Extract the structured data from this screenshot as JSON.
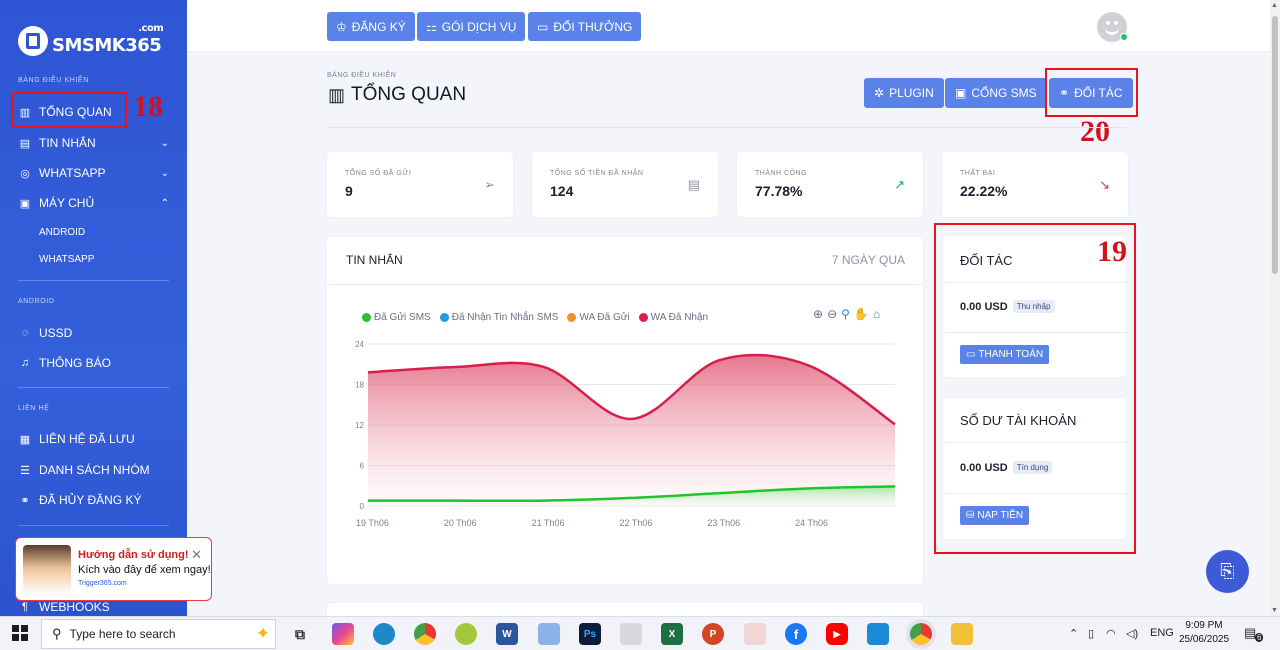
{
  "sidebar": {
    "logo_text": "SMSMK365",
    "logo_domain": ".com",
    "section_dashboard": "BẢNG ĐIỀU KHIỂN",
    "items": [
      {
        "label": "TỔNG QUAN"
      },
      {
        "label": "TIN NHẮN"
      },
      {
        "label": "WHATSAPP"
      },
      {
        "label": "MÁY CHỦ"
      }
    ],
    "subitems": [
      {
        "label": "ANDROID"
      },
      {
        "label": "WHATSAPP"
      }
    ],
    "section_android": "ANDROID",
    "android_items": [
      {
        "label": "USSD"
      },
      {
        "label": "THÔNG BÁO"
      }
    ],
    "section_contacts": "LIÊN HỆ",
    "contact_items": [
      {
        "label": "LIÊN HỆ ĐÃ LƯU"
      },
      {
        "label": "DANH SÁCH NHÓM"
      },
      {
        "label": "ĐÃ HỦY ĐĂNG KÝ"
      }
    ],
    "bottom_item": "WEBHOOKS"
  },
  "topbar": {
    "buttons": [
      {
        "label": "ĐĂNG KÝ"
      },
      {
        "label": "GÓI DỊCH VỤ"
      },
      {
        "label": "ĐỔI THƯỞNG"
      }
    ]
  },
  "header": {
    "breadcrumb": "BẢNG ĐIỀU KHIỂN",
    "title": "TỔNG QUAN",
    "buttons": [
      {
        "label": "PLUGIN"
      },
      {
        "label": "CỔNG SMS"
      },
      {
        "label": "ĐỐI TÁC"
      }
    ]
  },
  "annotations": {
    "n18": "18",
    "n19": "19",
    "n20": "20"
  },
  "stats": [
    {
      "label": "TỔNG SỐ ĐÃ GỬI",
      "value": "9"
    },
    {
      "label": "TỔNG SỐ TIỀN ĐÃ NHẬN",
      "value": "124"
    },
    {
      "label": "THÀNH CÔNG",
      "value": "77.78%"
    },
    {
      "label": "THẤT BẠI",
      "value": "22.22%"
    }
  ],
  "chart_card": {
    "title": "TIN NHẮN",
    "subtitle": "7 NGÀY QUA"
  },
  "chart_data": {
    "type": "area",
    "x": [
      "19 Th06",
      "20 Th06",
      "21 Th06",
      "22 Th06",
      "23 Th06",
      "24 Th06",
      ""
    ],
    "ylim": [
      0,
      24
    ],
    "yticks": [
      "0",
      "6",
      "12",
      "18",
      "24"
    ],
    "series": [
      {
        "name": "Đã Gửi SMS",
        "color": "#22c42a",
        "values": [
          0.8,
          0.8,
          0.8,
          1.2,
          1.9,
          2.6,
          2.9
        ]
      },
      {
        "name": "Đã Nhận Tin Nhắn SMS",
        "color": "#1e9be9",
        "values": [
          null,
          null,
          null,
          null,
          null,
          null,
          null
        ]
      },
      {
        "name": "WA Đã Gửi",
        "color": "#f4902c",
        "values": [
          null,
          null,
          null,
          null,
          null,
          null,
          null
        ]
      },
      {
        "name": "WA Đã Nhận",
        "color": "#d81e4b",
        "values": [
          19.8,
          20.6,
          20.6,
          12.9,
          21.6,
          20.9,
          12.1
        ]
      }
    ]
  },
  "partner_panel": {
    "title": "ĐỐI TÁC",
    "amount": "0.00 USD",
    "badge": "Thu nhập",
    "button": "THANH TOÁN"
  },
  "balance_panel": {
    "title": "SỐ DƯ TÀI KHOẢN",
    "amount": "0.00 USD",
    "badge": "Tín dụng",
    "button": "NẠP TIỀN"
  },
  "help_popup": {
    "title": "Hướng dẫn sử dụng!",
    "text": "Kích vào đây để xem ngay!",
    "link": "Trigger365.com"
  },
  "taskbar": {
    "search_placeholder": "Type here to search",
    "language": "ENG",
    "time": "9:09 PM",
    "date": "25/06/2025",
    "notifications": "6"
  }
}
